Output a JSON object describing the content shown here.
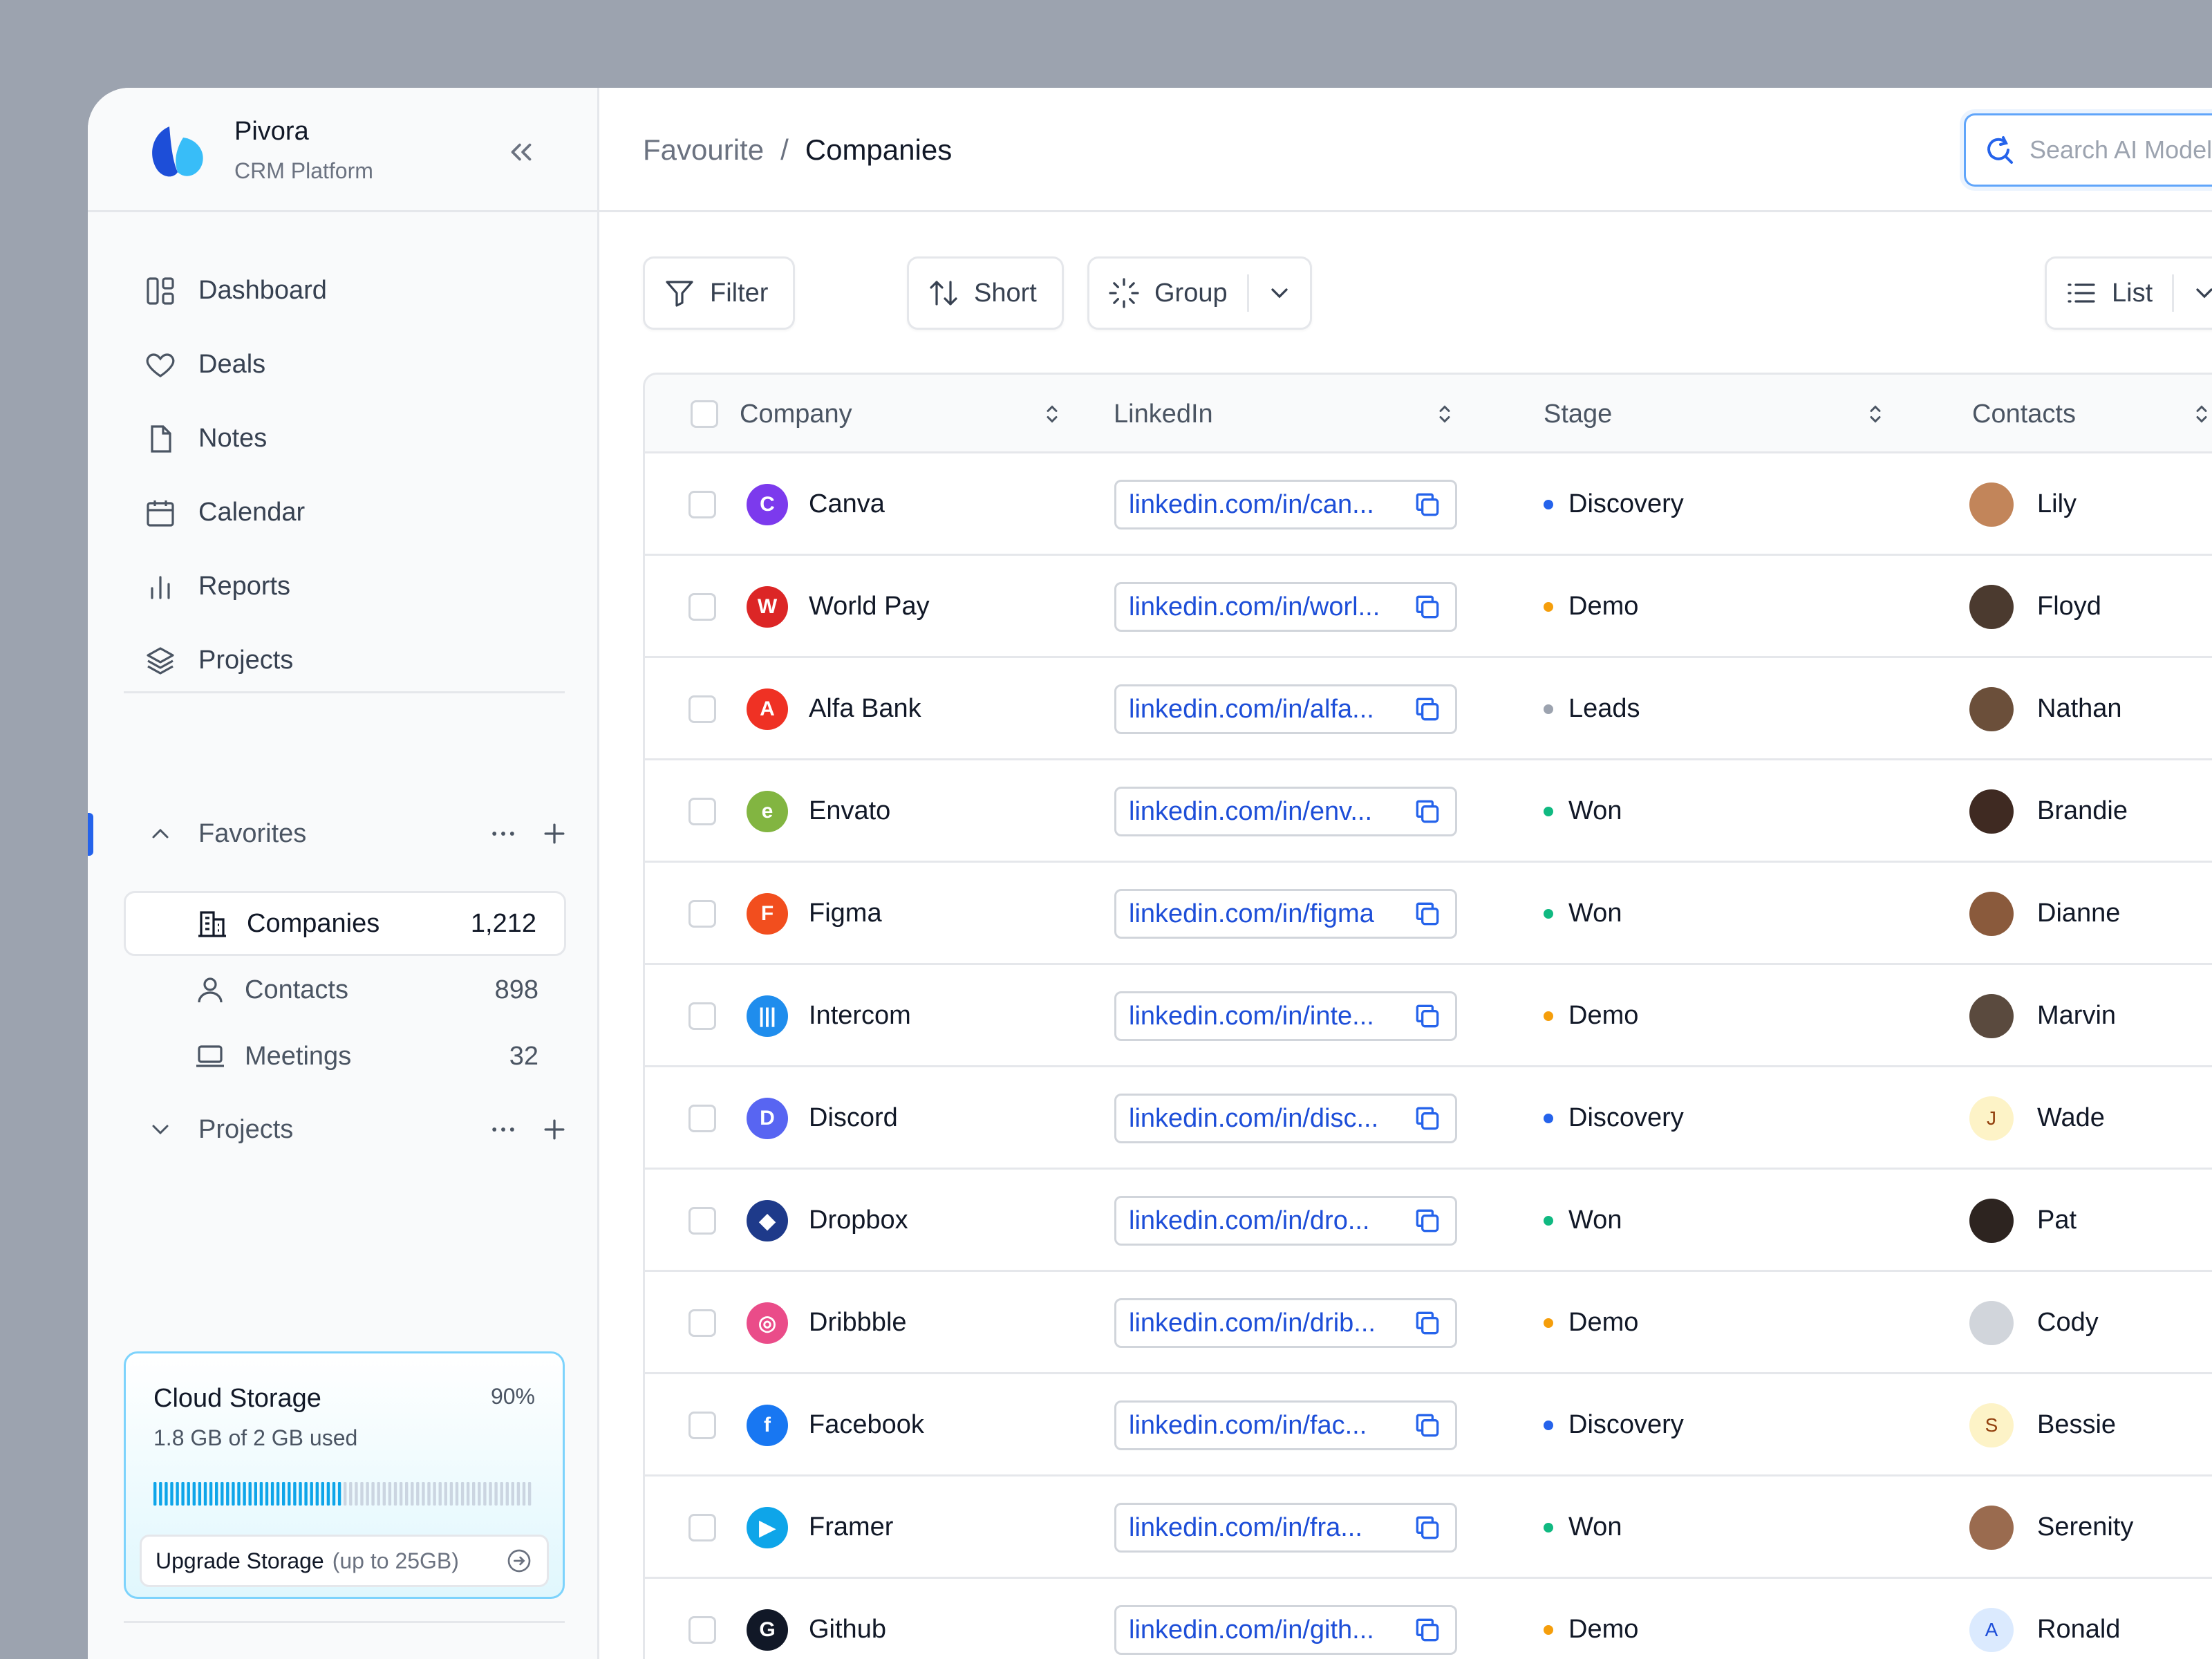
{
  "brand": {
    "name": "Pivora",
    "subtitle": "CRM Platform"
  },
  "nav": [
    {
      "label": "Dashboard",
      "icon": "dashboard-icon"
    },
    {
      "label": "Deals",
      "icon": "heart-icon"
    },
    {
      "label": "Notes",
      "icon": "file-icon"
    },
    {
      "label": "Calendar",
      "icon": "calendar-icon"
    },
    {
      "label": "Reports",
      "icon": "bar-chart-icon"
    },
    {
      "label": "Projects",
      "icon": "layers-icon"
    }
  ],
  "favorites": {
    "label": "Favorites",
    "items": [
      {
        "label": "Companies",
        "count": "1,212",
        "icon": "building-icon",
        "active": true
      },
      {
        "label": "Contacts",
        "count": "898",
        "icon": "user-icon",
        "active": false
      },
      {
        "label": "Meetings",
        "count": "32",
        "icon": "laptop-icon",
        "active": false
      }
    ]
  },
  "projects_section": {
    "label": "Projects"
  },
  "storage": {
    "title": "Cloud Storage",
    "percent_label": "90%",
    "used_fraction": 0.9,
    "used_text": "1.8 GB of 2 GB used",
    "upgrade_label": "Upgrade Storage",
    "upgrade_note": "(up to 25GB)"
  },
  "breadcrumb": {
    "parent": "Favourite",
    "separator": "/",
    "current": "Companies"
  },
  "search": {
    "placeholder": "Search AI Model"
  },
  "toolbar": {
    "filter": "Filter",
    "sort": "Short",
    "group": "Group",
    "view": "List"
  },
  "table": {
    "columns": {
      "company": "Company",
      "linkedin": "LinkedIn",
      "stage": "Stage",
      "contacts": "Contacts"
    },
    "stage_colors": {
      "Discovery": "#2563eb",
      "Demo": "#f59e0b",
      "Leads": "#9ca3af",
      "Won": "#10b981"
    },
    "rows": [
      {
        "company": "Canva",
        "logo_color": "#7c3aed",
        "logo_glyph": "C",
        "linkedin": "linkedin.com/in/can...",
        "stage": "Discovery",
        "contact": "Lily",
        "avatar_bg": "#c2855a",
        "avatar_text": ""
      },
      {
        "company": "World Pay",
        "logo_color": "#dc2626",
        "logo_glyph": "W",
        "linkedin": "linkedin.com/in/worl...",
        "stage": "Demo",
        "contact": "Floyd",
        "avatar_bg": "#4b3a2f",
        "avatar_text": ""
      },
      {
        "company": "Alfa Bank",
        "logo_color": "#ef3124",
        "logo_glyph": "A",
        "linkedin": "linkedin.com/in/alfa...",
        "stage": "Leads",
        "contact": "Nathan",
        "avatar_bg": "#6b4f3a",
        "avatar_text": ""
      },
      {
        "company": "Envato",
        "logo_color": "#82b541",
        "logo_glyph": "e",
        "linkedin": "linkedin.com/in/env...",
        "stage": "Won",
        "contact": "Brandie",
        "avatar_bg": "#3f2a22",
        "avatar_text": ""
      },
      {
        "company": "Figma",
        "logo_color": "#f24e1e",
        "logo_glyph": "F",
        "linkedin": "linkedin.com/in/figma",
        "stage": "Won",
        "contact": "Dianne",
        "avatar_bg": "#8a5a3c",
        "avatar_text": ""
      },
      {
        "company": "Intercom",
        "logo_color": "#1f8ded",
        "logo_glyph": "|||",
        "linkedin": "linkedin.com/in/inte...",
        "stage": "Demo",
        "contact": "Marvin",
        "avatar_bg": "#5a4a3e",
        "avatar_text": ""
      },
      {
        "company": "Discord",
        "logo_color": "#5865f2",
        "logo_glyph": "D",
        "linkedin": "linkedin.com/in/disc...",
        "stage": "Discovery",
        "contact": "Wade",
        "avatar_bg": "#fdf3c7",
        "avatar_text": "J"
      },
      {
        "company": "Dropbox",
        "logo_color": "#1e3a8a",
        "logo_glyph": "◆",
        "linkedin": "linkedin.com/in/dro...",
        "stage": "Won",
        "contact": "Pat",
        "avatar_bg": "#2d2420",
        "avatar_text": ""
      },
      {
        "company": "Dribbble",
        "logo_color": "#ea4c89",
        "logo_glyph": "◎",
        "linkedin": "linkedin.com/in/drib...",
        "stage": "Demo",
        "contact": "Cody",
        "avatar_bg": "#d1d5db",
        "avatar_text": ""
      },
      {
        "company": "Facebook",
        "logo_color": "#1877f2",
        "logo_glyph": "f",
        "linkedin": "linkedin.com/in/fac...",
        "stage": "Discovery",
        "contact": "Bessie",
        "avatar_bg": "#fdf3c7",
        "avatar_text": "S"
      },
      {
        "company": "Framer",
        "logo_color": "#0ea5e9",
        "logo_glyph": "▶",
        "linkedin": "linkedin.com/in/fra...",
        "stage": "Won",
        "contact": "Serenity",
        "avatar_bg": "#9a6b4f",
        "avatar_text": ""
      },
      {
        "company": "Github",
        "logo_color": "#111827",
        "logo_glyph": "G",
        "linkedin": "linkedin.com/in/gith...",
        "stage": "Demo",
        "contact": "Ronald",
        "avatar_bg": "#dbeafe",
        "avatar_text": "A"
      }
    ]
  }
}
